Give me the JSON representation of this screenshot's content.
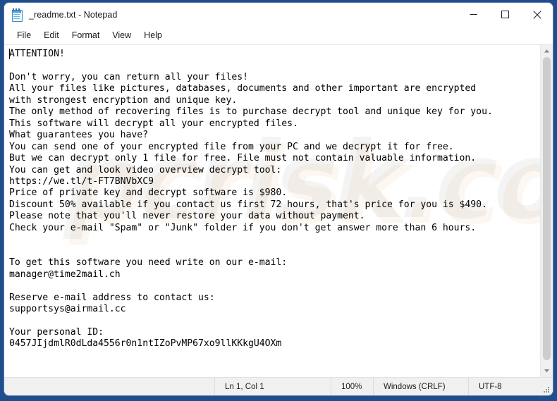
{
  "window": {
    "title": "_readme.txt - Notepad",
    "icon": "notepad-icon",
    "frame_color": "#1f4e8c",
    "controls": {
      "minimize": "minimize-icon",
      "maximize": "maximize-icon",
      "close": "close-icon"
    }
  },
  "menubar": {
    "items": [
      {
        "label": "File"
      },
      {
        "label": "Edit"
      },
      {
        "label": "Format"
      },
      {
        "label": "View"
      },
      {
        "label": "Help"
      }
    ]
  },
  "editor": {
    "watermark": "pcrisk.com",
    "content": "ATTENTION!\n\nDon't worry, you can return all your files!\nAll your files like pictures, databases, documents and other important are encrypted\nwith strongest encryption and unique key.\nThe only method of recovering files is to purchase decrypt tool and unique key for you.\nThis software will decrypt all your encrypted files.\nWhat guarantees you have?\nYou can send one of your encrypted file from your PC and we decrypt it for free.\nBut we can decrypt only 1 file for free. File must not contain valuable information.\nYou can get and look video overview decrypt tool:\nhttps://we.tl/t-FT7BNVbXC9\nPrice of private key and decrypt software is $980.\nDiscount 50% available if you contact us first 72 hours, that's price for you is $490.\nPlease note that you'll never restore your data without payment.\nCheck your e-mail \"Spam\" or \"Junk\" folder if you don't get answer more than 6 hours.\n\n\nTo get this software you need write on our e-mail:\nmanager@time2mail.ch\n\nReserve e-mail address to contact us:\nsupportsys@airmail.cc\n\nYour personal ID:\n0457JIjdmlR0dLda4556r0n1ntIZoPvMP67xo9llKKkgU4OXm",
    "details": {
      "heading": "ATTENTION!",
      "video_url": "https://we.tl/t-FT7BNVbXC9",
      "price": "$980",
      "discount_price": "$490",
      "discount_percent": "50%",
      "discount_window_hours": "72 hours",
      "answer_window_hours": "6 hours",
      "free_files": "1 file",
      "primary_email": "manager@time2mail.ch",
      "reserve_email": "supportsys@airmail.cc",
      "personal_id": "0457JIjdmlR0dLda4556r0n1ntIZoPvMP67xo9llKKkgU4OXm"
    }
  },
  "scrollbar": {
    "up_arrow": "scroll-up-icon",
    "down_arrow": "scroll-down-icon"
  },
  "statusbar": {
    "position": "Ln 1, Col 1",
    "zoom": "100%",
    "line_ending": "Windows (CRLF)",
    "encoding": "UTF-8"
  }
}
